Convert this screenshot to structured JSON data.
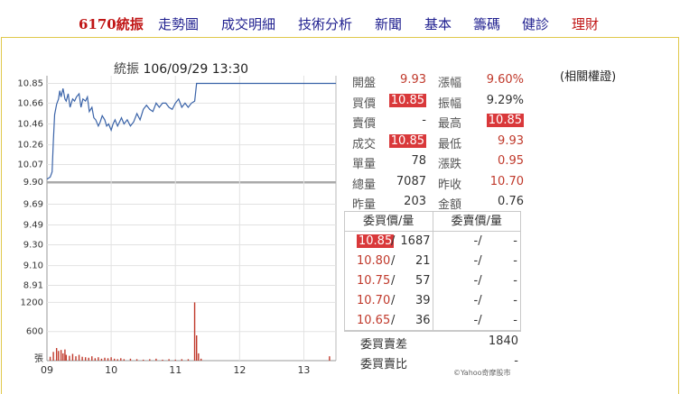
{
  "nav": {
    "items": [
      {
        "label": "6170統振",
        "style": "first",
        "name": "nav-stock-code"
      },
      {
        "label": "走勢圖",
        "style": "normal",
        "name": "nav-trend-chart"
      },
      {
        "label": "成交明細",
        "style": "normal",
        "name": "nav-trade-details"
      },
      {
        "label": "技術分析",
        "style": "normal",
        "name": "nav-technical-analysis"
      },
      {
        "label": "新聞",
        "style": "normal",
        "name": "nav-news"
      },
      {
        "label": "基本",
        "style": "normal",
        "name": "nav-basic"
      },
      {
        "label": "籌碼",
        "style": "normal",
        "name": "nav-chips"
      },
      {
        "label": "健診",
        "style": "normal",
        "name": "nav-health-check"
      },
      {
        "label": "理財",
        "style": "red",
        "name": "nav-finance"
      }
    ]
  },
  "chart_header": {
    "name": "統振",
    "datetime": "106/09/29 13:30"
  },
  "related_link": "(相關權證)",
  "quote": {
    "rows": [
      {
        "l1": "開盤",
        "v1": "9.93",
        "c1": "red",
        "l2": "漲幅",
        "v2": "9.60%",
        "c2": "red"
      },
      {
        "l1": "買價",
        "v1": "10.85",
        "c1": "hl",
        "l2": "振幅",
        "v2": "9.29%",
        "c2": "dark"
      },
      {
        "l1": "賣價",
        "v1": "-",
        "c1": "dark",
        "l2": "最高",
        "v2": "10.85",
        "c2": "hl"
      },
      {
        "l1": "成交",
        "v1": "10.85",
        "c1": "hl",
        "l2": "最低",
        "v2": "9.93",
        "c2": "red"
      },
      {
        "l1": "單量",
        "v1": "78",
        "c1": "dark",
        "l2": "漲跌",
        "v2": "0.95",
        "c2": "red"
      },
      {
        "l1": "總量",
        "v1": "7087",
        "c1": "dark",
        "l2": "昨收",
        "v2": "10.70",
        "c2": "red"
      },
      {
        "l1": "昨量",
        "v1": "203",
        "c1": "dark",
        "l2": "金額",
        "v2": "0.76",
        "c2": "dark"
      }
    ]
  },
  "orderbook": {
    "buy_header": "委買價/量",
    "sell_header": "委賣價/量",
    "rows": [
      {
        "bp": "10.85",
        "bv": "1687",
        "sp": "-/",
        "sv": "-",
        "hl": true
      },
      {
        "bp": "10.80",
        "bv": "21",
        "sp": "-/",
        "sv": "-",
        "hl": false
      },
      {
        "bp": "10.75",
        "bv": "57",
        "sp": "-/",
        "sv": "-",
        "hl": false
      },
      {
        "bp": "10.70",
        "bv": "39",
        "sp": "-/",
        "sv": "-",
        "hl": false
      },
      {
        "bp": "10.65",
        "bv": "36",
        "sp": "-/",
        "sv": "-",
        "hl": false
      }
    ]
  },
  "summary": {
    "diff_label": "委買賣差",
    "diff_value": "1840",
    "ratio_label": "委買賣比",
    "ratio_value": "-"
  },
  "credit": "©Yahoo奇摩股市",
  "colors": {
    "price_line": "#3a63a8",
    "volume_bar": "#c0392b",
    "ref_line": "#aaaaaa",
    "highlight": "#d9383a"
  },
  "chart_data": {
    "type": "line",
    "price": {
      "x": [
        9.0,
        9.05,
        9.08,
        9.1,
        9.12,
        9.15,
        9.18,
        9.2,
        9.22,
        9.25,
        9.28,
        9.3,
        9.33,
        9.36,
        9.4,
        9.43,
        9.46,
        9.5,
        9.53,
        9.56,
        9.6,
        9.63,
        9.66,
        9.7,
        9.73,
        9.76,
        9.8,
        9.83,
        9.86,
        9.9,
        9.93,
        9.96,
        10.0,
        10.03,
        10.06,
        10.1,
        10.13,
        10.16,
        10.2,
        10.25,
        10.3,
        10.35,
        10.4,
        10.45,
        10.5,
        10.55,
        10.6,
        10.65,
        10.7,
        10.75,
        10.8,
        10.85,
        10.9,
        10.95,
        11.0,
        11.05,
        11.1,
        11.15,
        11.2,
        11.25,
        11.3,
        11.33,
        11.4,
        11.6,
        11.8,
        12.0,
        12.2,
        12.4,
        12.6,
        12.8,
        13.0,
        13.2,
        13.5
      ],
      "y": [
        9.93,
        9.95,
        10.0,
        10.3,
        10.55,
        10.65,
        10.7,
        10.78,
        10.72,
        10.8,
        10.7,
        10.68,
        10.75,
        10.62,
        10.7,
        10.68,
        10.72,
        10.75,
        10.62,
        10.7,
        10.68,
        10.72,
        10.58,
        10.62,
        10.52,
        10.5,
        10.44,
        10.48,
        10.54,
        10.5,
        10.44,
        10.46,
        10.4,
        10.46,
        10.5,
        10.44,
        10.48,
        10.52,
        10.46,
        10.5,
        10.44,
        10.48,
        10.56,
        10.5,
        10.6,
        10.64,
        10.6,
        10.58,
        10.66,
        10.62,
        10.66,
        10.66,
        10.62,
        10.6,
        10.66,
        10.7,
        10.62,
        10.66,
        10.62,
        10.66,
        10.68,
        10.85,
        10.85,
        10.85,
        10.85,
        10.85,
        10.85,
        10.85,
        10.85,
        10.85,
        10.85,
        10.85,
        10.85
      ],
      "ylim": [
        8.88,
        10.88
      ],
      "yticks": [
        "10.85",
        "10.66",
        "10.46",
        "10.26",
        "10.07",
        "9.90",
        "9.69",
        "9.49",
        "9.30",
        "9.10",
        "8.91"
      ],
      "ref": 9.9
    },
    "volume": {
      "x": [
        9.05,
        9.1,
        9.15,
        9.18,
        9.22,
        9.25,
        9.28,
        9.3,
        9.35,
        9.4,
        9.45,
        9.5,
        9.55,
        9.6,
        9.65,
        9.7,
        9.75,
        9.8,
        9.85,
        9.9,
        9.95,
        10.0,
        10.05,
        10.1,
        10.15,
        10.2,
        10.3,
        10.4,
        10.5,
        10.6,
        10.7,
        10.8,
        10.9,
        11.0,
        11.1,
        11.2,
        11.3,
        11.33,
        11.36,
        11.4,
        13.4
      ],
      "values": [
        80,
        180,
        260,
        200,
        220,
        150,
        230,
        120,
        100,
        140,
        90,
        120,
        80,
        70,
        60,
        90,
        50,
        70,
        40,
        60,
        50,
        70,
        40,
        30,
        50,
        30,
        40,
        30,
        20,
        30,
        40,
        20,
        30,
        20,
        30,
        30,
        1200,
        520,
        150,
        40,
        90
      ],
      "yticks": [
        "1200",
        "600",
        "張"
      ]
    },
    "xticks": [
      "09",
      "10",
      "11",
      "12",
      "13"
    ],
    "xlim": [
      9.0,
      13.5
    ]
  }
}
